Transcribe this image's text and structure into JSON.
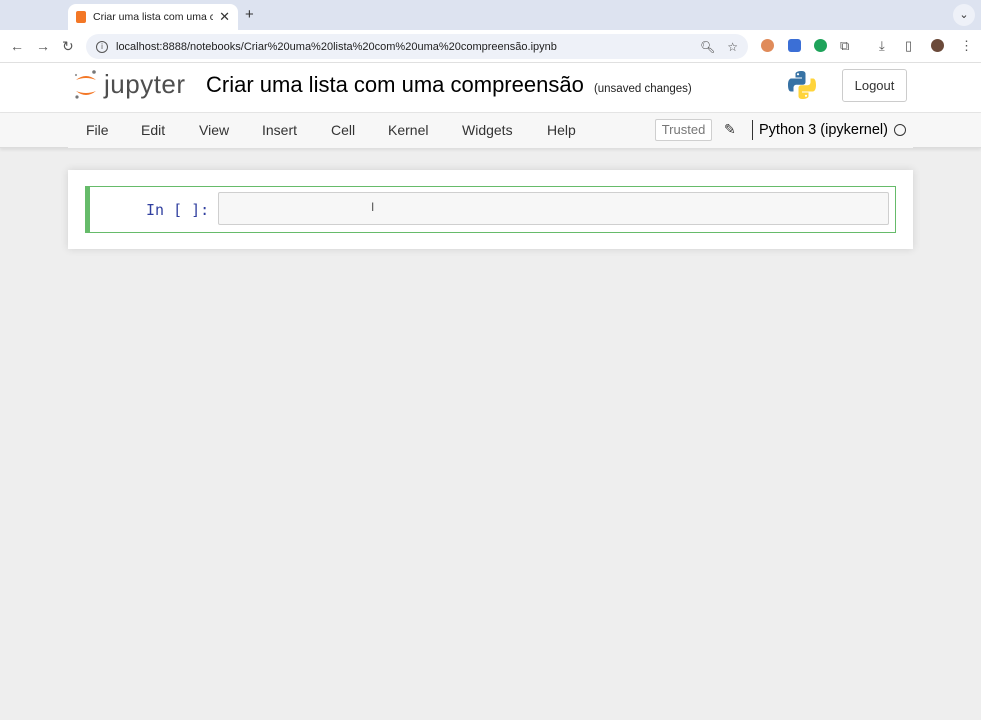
{
  "browser": {
    "tab_title": "Criar uma lista com uma com",
    "url": "localhost:8888/notebooks/Criar%20uma%20lista%20com%20uma%20compreensão.ipynb"
  },
  "header": {
    "logo_text": "jupyter",
    "notebook_title": "Criar uma lista com uma compreensão",
    "save_status": "(unsaved changes)",
    "logout_label": "Logout"
  },
  "menu": {
    "items": [
      "File",
      "Edit",
      "View",
      "Insert",
      "Cell",
      "Kernel",
      "Widgets",
      "Help"
    ],
    "trusted_label": "Trusted",
    "kernel_name": "Python 3 (ipykernel)"
  },
  "cell": {
    "prompt": "In [ ]:",
    "content": ""
  },
  "colors": {
    "accent_orange": "#f37726",
    "cell_border": "#66bb6a",
    "prompt_color": "#303f9f"
  }
}
